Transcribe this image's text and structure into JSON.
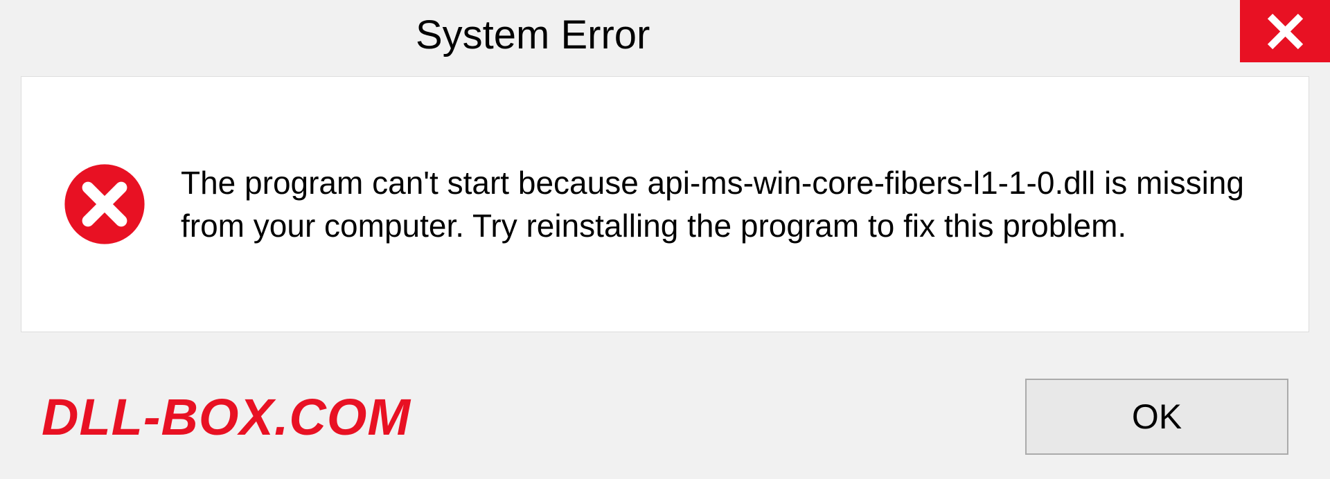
{
  "dialog": {
    "title": "System Error",
    "message": "The program can't start because api-ms-win-core-fibers-l1-1-0.dll is missing from your computer. Try reinstalling the program to fix this problem.",
    "ok_label": "OK"
  },
  "watermark": {
    "text": "DLL-BOX.COM"
  },
  "icons": {
    "close": "close-icon",
    "error": "error-circle-icon"
  },
  "colors": {
    "accent_red": "#e81123",
    "panel_bg": "#ffffff",
    "window_bg": "#f1f1f1",
    "button_bg": "#e8e8e8"
  }
}
